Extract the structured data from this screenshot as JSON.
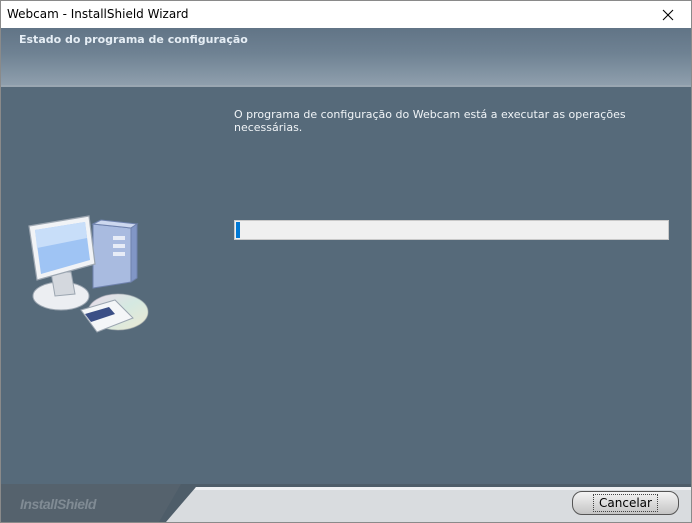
{
  "window": {
    "title": "Webcam - InstallShield Wizard",
    "close_icon": "close-icon"
  },
  "header": {
    "title": "Estado do programa de configuração"
  },
  "main": {
    "status_text": "O programa de configuração do Webcam está a executar as operações necessárias.",
    "progress_fraction": 0.01,
    "illustration_icon": "computer-setup-icon"
  },
  "footer": {
    "brand": "InstallShield",
    "cancel_label": "Cancelar"
  },
  "colors": {
    "banner": "#6f8293",
    "main_bg": "#566a7a",
    "progress_fill": "#0078d4",
    "footer_bg": "#4e5d69"
  }
}
